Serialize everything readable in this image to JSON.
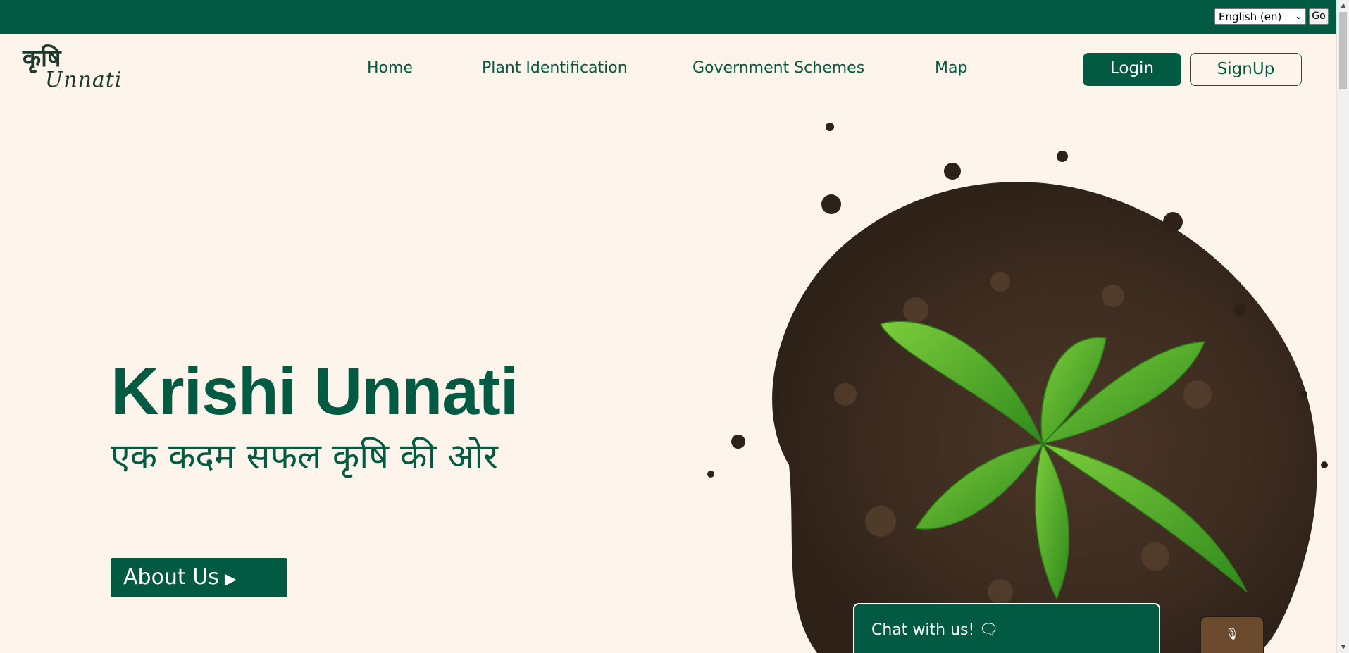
{
  "topbar": {
    "language_value": "English (en)",
    "go_label": "Go"
  },
  "logo": {
    "hindi_text": "कृषि",
    "english_text": "Unnati"
  },
  "nav": {
    "items": [
      {
        "label": "Home"
      },
      {
        "label": "Plant Identification"
      },
      {
        "label": "Government Schemes"
      },
      {
        "label": "Map"
      }
    ],
    "login_label": "Login",
    "signup_label": "SignUp"
  },
  "hero": {
    "title": "Krishi Unnati",
    "subtitle": "एक कदम सफल कृषि की ओर",
    "about_label": "About Us"
  },
  "chat": {
    "label": "Chat with us!",
    "icon": "chat-bubbles-icon"
  },
  "mic": {
    "icon": "microphone-icon"
  },
  "colors": {
    "primary": "#035a42",
    "background": "#fdf5eb",
    "mic_button": "#6b4a2d"
  }
}
